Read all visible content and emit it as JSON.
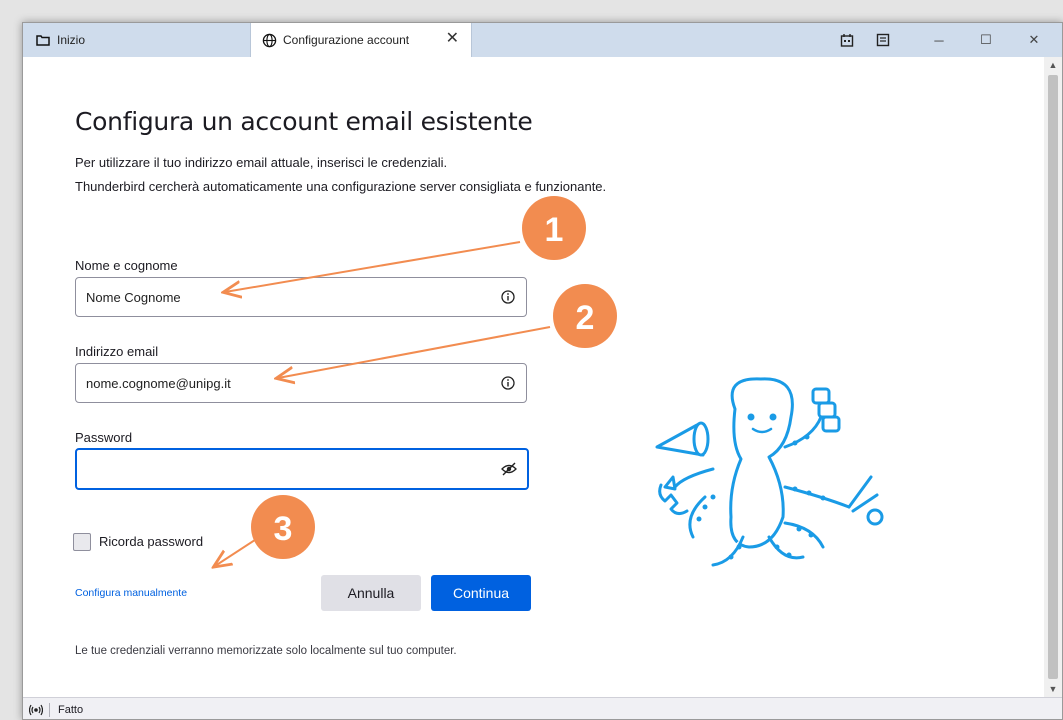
{
  "tabs": {
    "home": {
      "label": "Inizio",
      "icon": "folder-icon"
    },
    "active": {
      "label": "Configurazione account",
      "icon": "globe-icon",
      "close_label": "✕"
    }
  },
  "window_controls": {
    "minimize": "─",
    "maximize": "☐",
    "close": "✕"
  },
  "page": {
    "title": "Configura un account email esistente",
    "description_line1": "Per utilizzare il tuo indirizzo email attuale, inserisci le credenziali.",
    "description_line2": "Thunderbird cercherà automaticamente una configurazione server consigliata e funzionante."
  },
  "form": {
    "name_label": "Nome e cognome",
    "name_value": "Nome Cognome",
    "email_label": "Indirizzo email",
    "email_value": "nome.cognome@unipg.it",
    "password_label": "Password",
    "password_value": "",
    "remember_label": "Ricorda password",
    "remember_checked": false,
    "manual_link": "Configura manualmente",
    "cancel_label": "Annulla",
    "continue_label": "Continua",
    "note": "Le tue credenziali verranno memorizzate solo localmente sul tuo computer."
  },
  "status": {
    "text": "Fatto",
    "icon": "broadcast-icon"
  },
  "annotations": {
    "marker1": "1",
    "marker2": "2",
    "marker3": "3",
    "color": "#f28c50"
  },
  "colors": {
    "accent": "#0061e0",
    "titlebar": "#cfdcec"
  }
}
